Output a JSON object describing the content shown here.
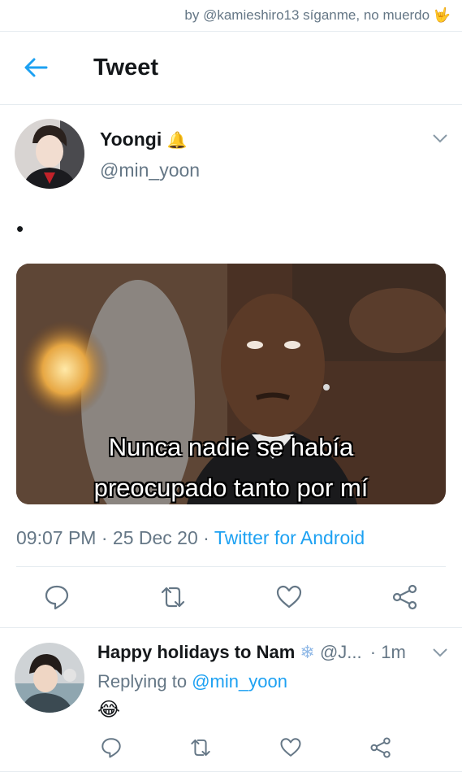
{
  "credit": {
    "text": "by @kamieshiro13 síganme, no muerdo",
    "emoji": "🤟"
  },
  "header": {
    "title": "Tweet",
    "back_icon": "arrow-left-icon"
  },
  "tweet": {
    "author_name": "Yoongi",
    "author_badge": "🔔",
    "author_handle": "@min_yoon",
    "text": "•",
    "media_caption_line1": "Nunca nadie se había",
    "media_caption_line2": "preocupado tanto por mí",
    "time": "09:07 PM",
    "date": "25 Dec 20",
    "source": "Twitter for Android",
    "actions": [
      "reply-icon",
      "retweet-icon",
      "like-icon",
      "share-icon"
    ]
  },
  "reply": {
    "author_name": "Happy holidays to Nam",
    "author_badge": "❄",
    "author_handle": "@J...",
    "time": "· 1m",
    "replying_prefix": "Replying to",
    "replying_handle": "@min_yoon",
    "text": "😂"
  },
  "colors": {
    "accent": "#1da1f2",
    "muted": "#657786",
    "text": "#14171a",
    "divider": "#e6ecf0"
  }
}
